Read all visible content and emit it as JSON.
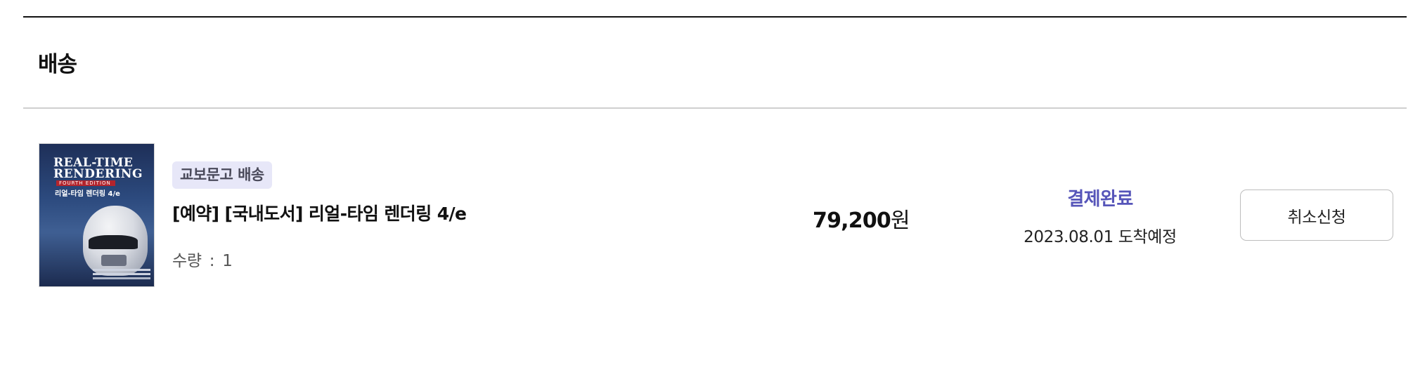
{
  "section": {
    "title": "배송"
  },
  "order_item": {
    "cover": {
      "title_line1": "REAL-TIME",
      "title_line2": "RENDERING",
      "edition": "FOURTH EDITION",
      "korean_title": "리얼-타임 렌더링 4/e"
    },
    "delivery_badge": "교보문고 배송",
    "product_title": "[예약] [국내도서] 리얼-타임 렌더링 4/e",
    "quantity_label": "수량",
    "quantity_separator": ":",
    "quantity_value": "1",
    "price_amount": "79,200",
    "price_unit": "원",
    "status": "결제완료",
    "arrival": "2023.08.01 도착예정",
    "cancel_button_label": "취소신청"
  },
  "colors": {
    "status_accent": "#5655b9",
    "badge_background": "#e7e7f8",
    "top_rule": "#111111",
    "divider": "#cfcfcf"
  }
}
